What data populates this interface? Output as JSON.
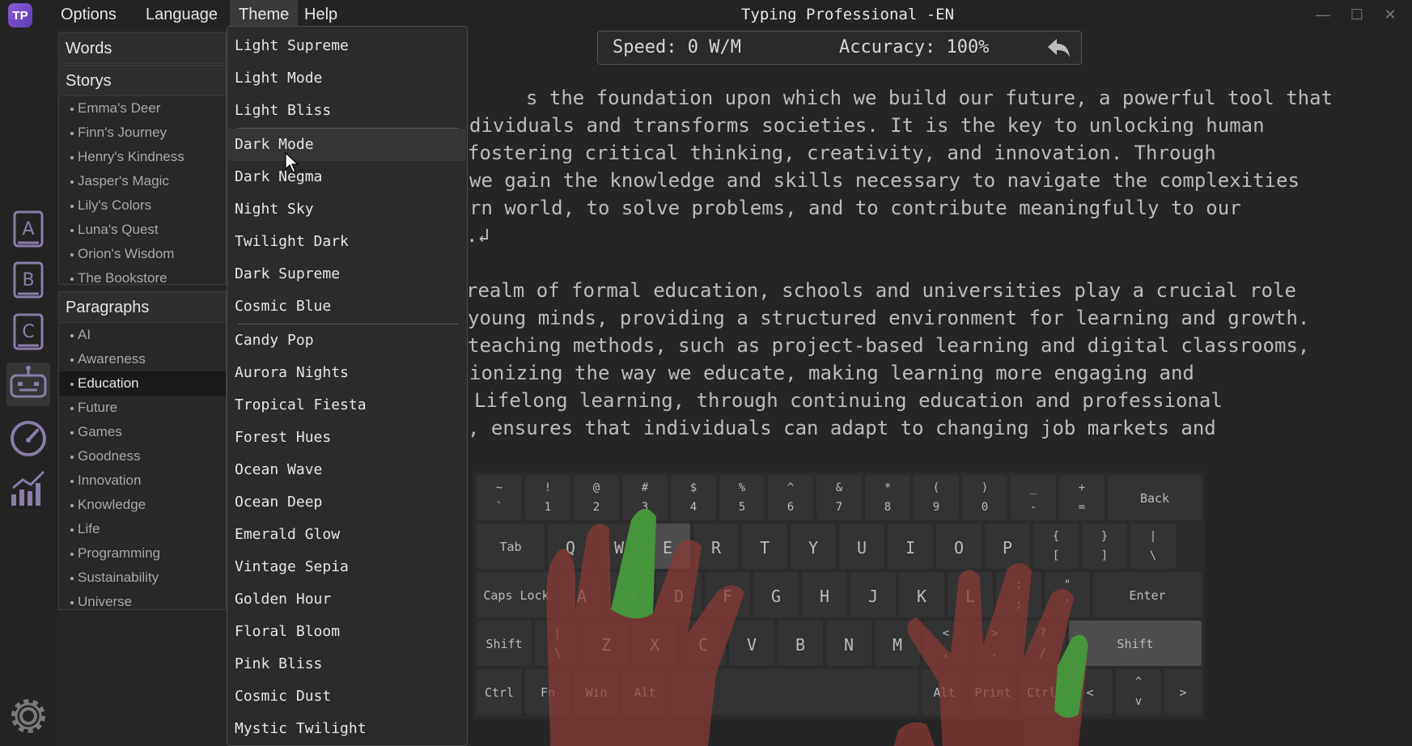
{
  "window": {
    "title": "Typing Professional -EN"
  },
  "logo": {
    "text": "TP"
  },
  "menubar": [
    {
      "id": "options",
      "label": "Options"
    },
    {
      "id": "language",
      "label": "Language"
    },
    {
      "id": "theme",
      "label": "Theme"
    },
    {
      "id": "help",
      "label": "Help"
    }
  ],
  "sidebar": {
    "words_header": "Words",
    "storys_header": "Storys",
    "storys": [
      "Emma's Deer",
      "Finn's Journey",
      "Henry's Kindness",
      "Jasper's Magic",
      "Lily's Colors",
      "Luna's Quest",
      "Orion's Wisdom",
      "The Bookstore"
    ],
    "paragraphs_header": "Paragraphs",
    "paragraphs": [
      "AI",
      "Awareness",
      "Education",
      "Future",
      "Games",
      "Goodness",
      "Innovation",
      "Knowledge",
      "Life",
      "Programming",
      "Sustainability",
      "Universe"
    ],
    "selected_paragraph": "Education"
  },
  "stats": {
    "speed": "Speed: 0 W/M",
    "accuracy": "Accuracy: 100%"
  },
  "text_lines": [
    "s the foundation upon which we build our future, a powerful tool that",
    "dividuals and transforms societies. It is the key to unlocking human",
    "fostering critical thinking, creativity, and innovation. Through",
    "we gain the knowledge and skills necessary to navigate the complexities",
    "rn world, to solve problems, and to contribute meaningfully to our",
    ".↲",
    "",
    "realm of formal education, schools and universities play a crucial role",
    "young minds, providing a structured environment for learning and growth.",
    "teaching methods, such as project-based learning and digital classrooms,",
    "ionizing the way we educate, making learning more engaging and",
    "Lifelong learning, through continuing education and professional",
    ", ensures that individuals can adapt to changing job markets and"
  ],
  "theme_menu": {
    "group1": [
      "Light Supreme",
      "Light Mode",
      "Light Bliss"
    ],
    "group2": [
      "Dark Mode",
      "Dark Negma",
      "Night Sky",
      "Twilight Dark",
      "Dark Supreme",
      "Cosmic Blue"
    ],
    "group3": [
      "Candy Pop",
      "Aurora Nights",
      "Tropical Fiesta",
      "Forest Hues",
      "Ocean Wave",
      "Ocean Deep",
      "Emerald Glow",
      "Vintage Sepia",
      "Golden Hour",
      "Floral Bloom",
      "Pink Bliss",
      "Cosmic Dust",
      "Mystic Twilight"
    ],
    "hovered": "Dark Mode"
  },
  "keyboard": {
    "row1": [
      [
        "~",
        "`"
      ],
      [
        "!",
        "1"
      ],
      [
        "@",
        "2"
      ],
      [
        "#",
        "3"
      ],
      [
        "$",
        "4"
      ],
      [
        "%",
        "5"
      ],
      [
        "^",
        "6"
      ],
      [
        "&",
        "7"
      ],
      [
        "*",
        "8"
      ],
      [
        "(",
        "9"
      ],
      [
        ")",
        "0"
      ],
      [
        "_",
        "-"
      ],
      [
        "+",
        "="
      ]
    ],
    "back": "Back",
    "tab": "Tab",
    "row2": [
      "Q",
      "W",
      "E",
      "R",
      "T",
      "Y",
      "U",
      "I",
      "O",
      "P"
    ],
    "row2_sym": [
      [
        "{",
        "["
      ],
      [
        "}",
        "]"
      ],
      [
        "|",
        "\\"
      ]
    ],
    "caps": "Caps Lock",
    "row3": [
      "A",
      "S",
      "D",
      "F",
      "G",
      "H",
      "J",
      "K",
      "L"
    ],
    "row3_sym": [
      [
        ":",
        ";"
      ],
      [
        "\"",
        "'"
      ]
    ],
    "enter": "Enter",
    "shift_left": "Shift",
    "row4_sym_left": [
      "|",
      "\\"
    ],
    "row4": [
      "Z",
      "X",
      "C",
      "V",
      "B",
      "N",
      "M"
    ],
    "row4_sym": [
      [
        "<",
        ","
      ],
      [
        ">",
        "."
      ],
      [
        "?",
        "/"
      ]
    ],
    "shift_right": "Shift",
    "row5": {
      "ctrl_left": "Ctrl",
      "fn": "Fn",
      "win": "Win",
      "alt_left": "Alt",
      "alt_right": "Alt",
      "print": "Print",
      "ctrl_right": "Ctrl",
      "left": "<",
      "up": "^",
      "down": "v",
      "right": ">"
    }
  },
  "colors": {
    "accent_green": "#3ea53e",
    "hand": "#8a3a34",
    "background": "#252525"
  }
}
